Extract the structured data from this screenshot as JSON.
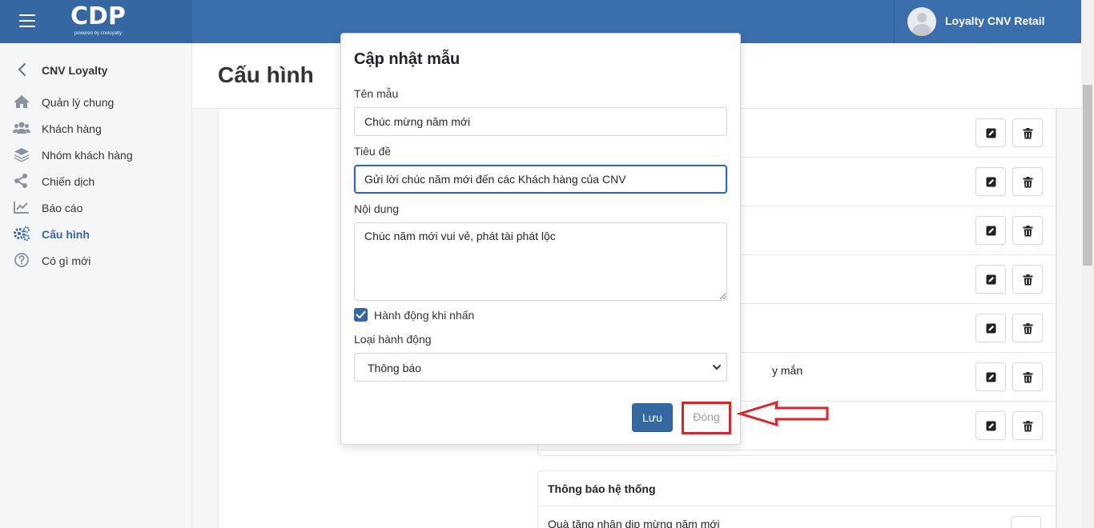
{
  "header": {
    "logo": "CDP",
    "logo_sub": "powered by cnvloyalty",
    "user_name": "Loyalty CNV Retail"
  },
  "sidebar": {
    "back_title": "CNV Loyalty",
    "items": [
      {
        "label": "Quản lý chung",
        "icon": "home-icon"
      },
      {
        "label": "Khách hàng",
        "icon": "users-icon"
      },
      {
        "label": "Nhóm khách hàng",
        "icon": "layers-icon"
      },
      {
        "label": "Chiến dịch",
        "icon": "share-icon"
      },
      {
        "label": "Báo cáo",
        "icon": "chart-line-icon"
      },
      {
        "label": "Cấu hình",
        "icon": "gears-icon",
        "active": true
      },
      {
        "label": "Có gì mới",
        "icon": "question-circle-icon"
      }
    ]
  },
  "page": {
    "title": "Cấu hình"
  },
  "template_list": {
    "rows": [
      {
        "text": ""
      },
      {
        "text": ""
      },
      {
        "text": ""
      },
      {
        "text": ""
      },
      {
        "text": ""
      },
      {
        "text": "y mắn"
      },
      {
        "text": ""
      }
    ]
  },
  "system_section": {
    "title": "Thông báo hệ thống",
    "first_row_text": "Quà tặng nhân dịp mừng năm mới"
  },
  "modal": {
    "title": "Cập nhật mẫu",
    "name_label": "Tên mẫu",
    "name_value": "Chúc mừng năm mới",
    "subject_label": "Tiêu đề",
    "subject_value": "Gửi lời chúc năm mới đến các Khách hàng của CNV",
    "content_label": "Nội dung",
    "content_value": "Chúc năm mới vui vẻ, phát tài phát lộc",
    "action_checkbox_label": "Hành động khi nhấn",
    "action_checked": true,
    "action_type_label": "Loại hành động",
    "action_type_value": "Thông báo",
    "save_label": "Lưu",
    "close_label": "Đóng"
  },
  "colors": {
    "primary": "#3567a3",
    "topbar": "#3a6eac",
    "annotation": "#e0232b"
  }
}
